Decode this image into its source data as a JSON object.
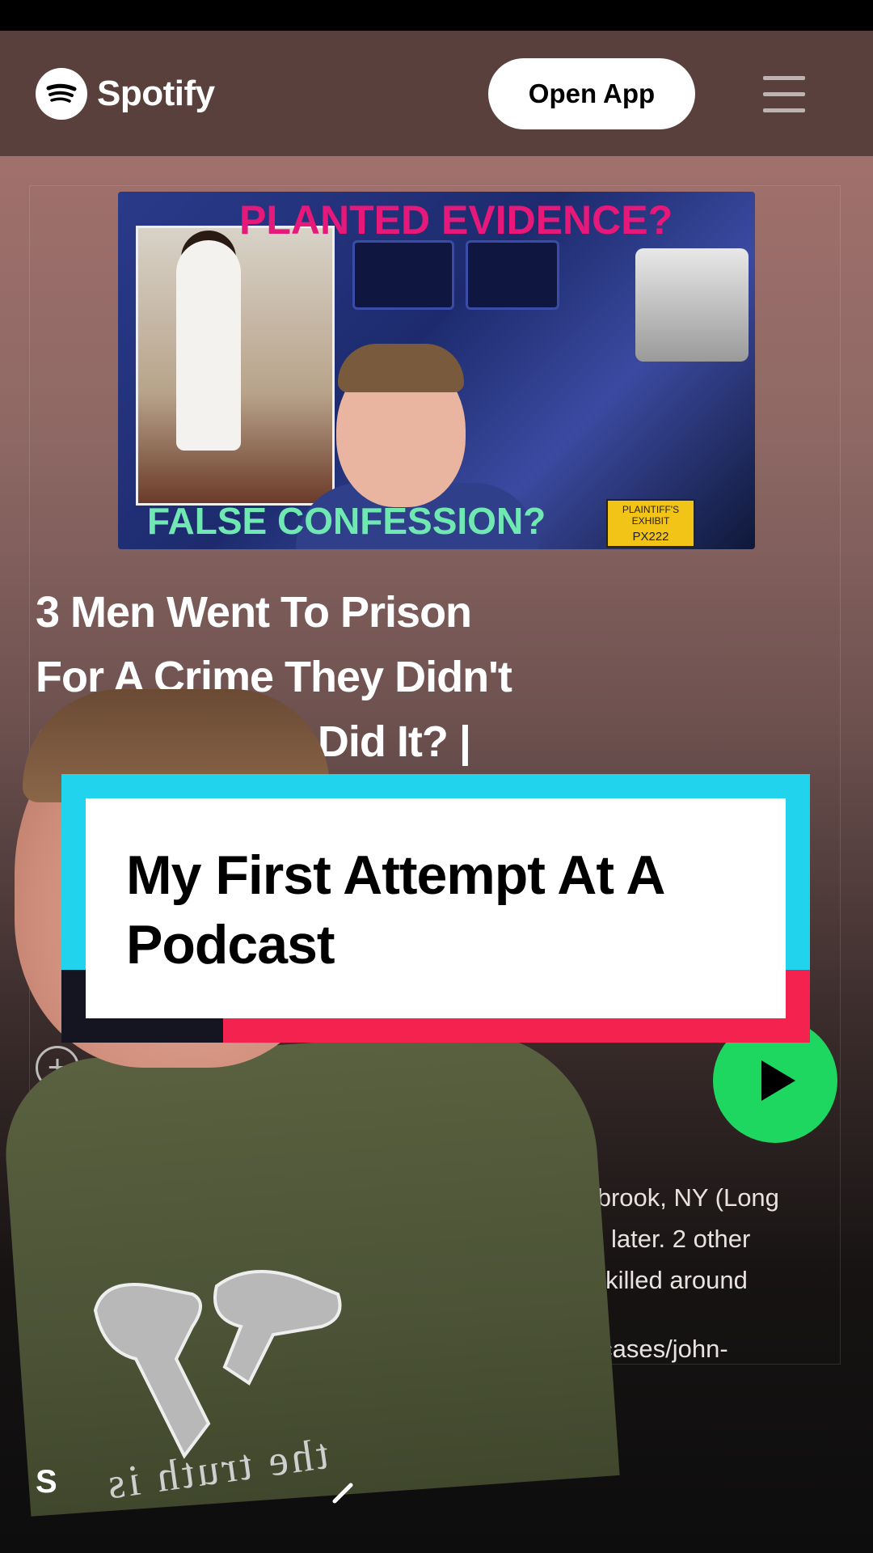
{
  "header": {
    "brand": "Spotify",
    "open_app_label": "Open App"
  },
  "cover": {
    "top_text": "PLANTED EVIDENCE?",
    "bottom_text": "FALSE CONFESSION?",
    "exhibit_label": "PLAINTIFF'S EXHIBIT",
    "exhibit_code": "PX222"
  },
  "episode": {
    "title_lines": [
      "3 Men Went To Prison",
      "For A Crime They Didn't",
      "C… …ut Who Did It? |"
    ]
  },
  "description": {
    "lines": [
      "ynbrook, NY (Long",
      "ths later. 2 other",
      "nd killed around"
    ],
    "link": "rg/cases/john-"
  },
  "overlay": {
    "caption_line1": "My First Attempt At A",
    "caption_line2": "Podcast"
  },
  "presenter": {
    "shirt_text": "the truth is"
  },
  "bottom": {
    "fragment": "S"
  },
  "icons": [
    "spotify-logo-icon",
    "menu-icon",
    "add-icon",
    "play-icon",
    "chevron-right-icon"
  ],
  "colors": {
    "header_bg": "#5a403d",
    "play_green": "#1ed760",
    "banner_cyan": "#22d3ee",
    "banner_red": "#f3224e",
    "cover_pink": "#e6197a",
    "cover_mint": "#6fe8b2"
  }
}
